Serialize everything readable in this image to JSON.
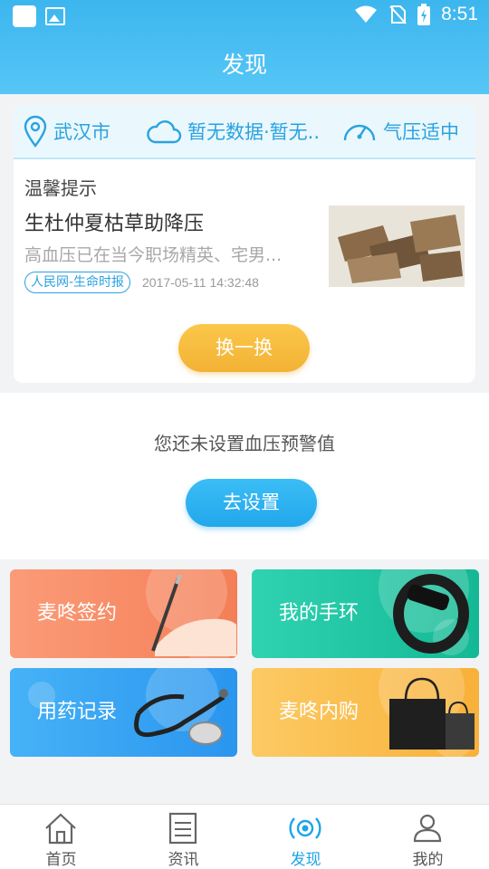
{
  "status_bar": {
    "time": "8:51"
  },
  "header": {
    "title": "发现"
  },
  "weather": {
    "city": "武汉市",
    "condition": "暂无数据·暂无..",
    "pressure": "气压适中"
  },
  "tip": {
    "label": "温馨提示",
    "headline": "生杜仲夏枯草助降压",
    "summary": "高血压已在当今职场精英、宅男...",
    "source": "人民网-生命时报",
    "date": "2017-05-11 14:32:48",
    "swap_label": "换一换"
  },
  "blood_pressure": {
    "notice": "您还未设置血压预警值",
    "setup_label": "去设置"
  },
  "tiles": [
    {
      "label": "麦咚签约",
      "color": "#f68a63"
    },
    {
      "label": "我的手环",
      "color": "#20c4a2"
    },
    {
      "label": "用药记录",
      "color": "#389ff1"
    },
    {
      "label": "麦咚内购",
      "color": "#f9bd4c"
    }
  ],
  "tabbar": {
    "items": [
      {
        "label": "首页",
        "icon": "home-icon"
      },
      {
        "label": "资讯",
        "icon": "news-icon"
      },
      {
        "label": "发现",
        "icon": "discover-icon",
        "active": true
      },
      {
        "label": "我的",
        "icon": "profile-icon"
      }
    ],
    "active_color": "#1ea4e8"
  }
}
